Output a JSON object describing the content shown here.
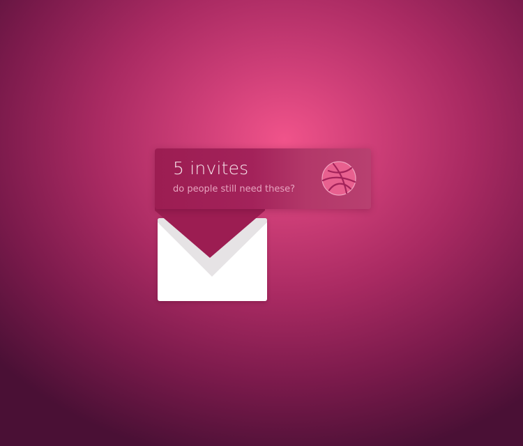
{
  "notification": {
    "title": "5 invites",
    "subtitle": "do people still need these?",
    "icon": "dribbble-icon"
  },
  "envelope": {
    "icon": "envelope-icon"
  },
  "colors": {
    "background_center": "#f0538a",
    "background_edge": "#4a1035",
    "card": "#a3225a",
    "icon_ball": "#e8608f",
    "envelope": "#ffffff"
  }
}
